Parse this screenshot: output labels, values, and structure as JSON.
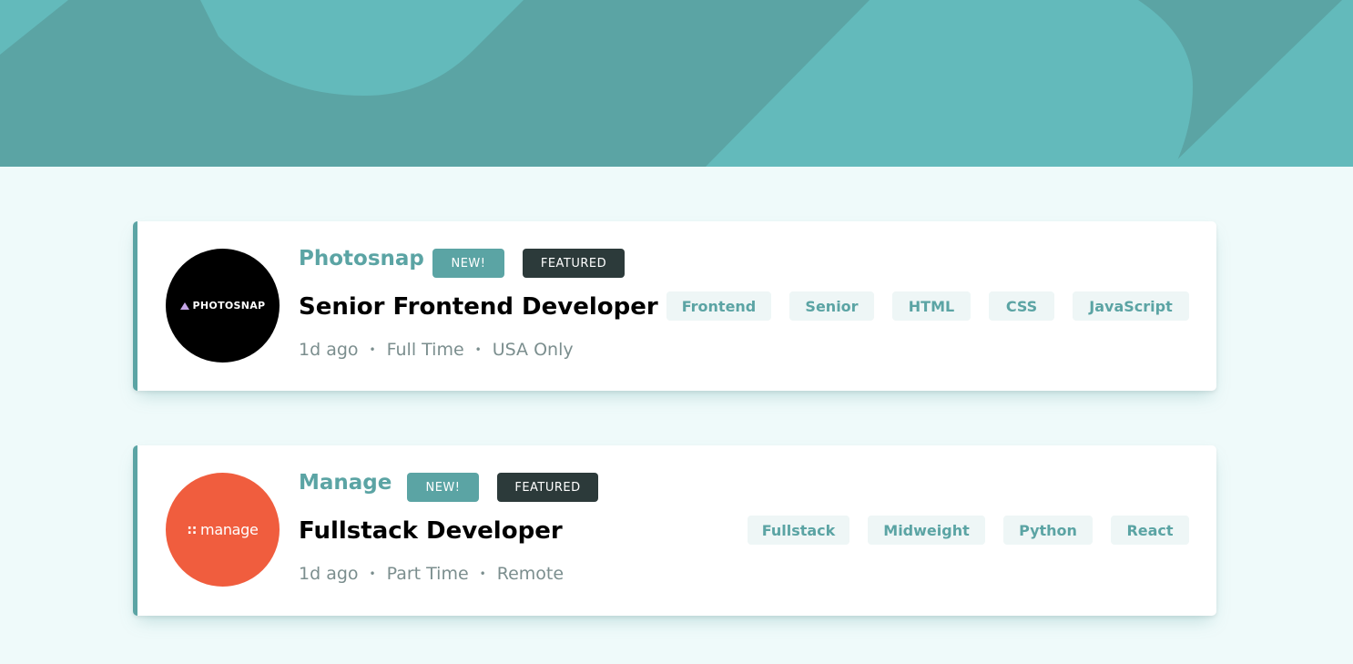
{
  "colors": {
    "primary": "#5ba4a4",
    "dark": "#2c3a3a",
    "background": "#effafa",
    "tag_bg": "#eef6f6",
    "meta_text": "#7b8e8e"
  },
  "jobs": [
    {
      "logo_text": "PHOTOSNAP",
      "logo_icon": "triangle-icon",
      "logo_color": "#000000",
      "company": "Photosnap",
      "new_label": "NEW!",
      "featured_label": "FEATURED",
      "position": "Senior Frontend Developer",
      "posted": "1d ago",
      "contract": "Full Time",
      "location": "USA Only",
      "separator": "•",
      "tags": [
        "Frontend",
        "Senior",
        "HTML",
        "CSS",
        "JavaScript"
      ]
    },
    {
      "logo_text": "manage",
      "logo_icon": "dots-icon",
      "logo_color": "#f05d3e",
      "company": "Manage",
      "new_label": "NEW!",
      "featured_label": "FEATURED",
      "position": "Fullstack Developer",
      "posted": "1d ago",
      "contract": "Part Time",
      "location": "Remote",
      "separator": "•",
      "tags": [
        "Fullstack",
        "Midweight",
        "Python",
        "React"
      ]
    }
  ]
}
